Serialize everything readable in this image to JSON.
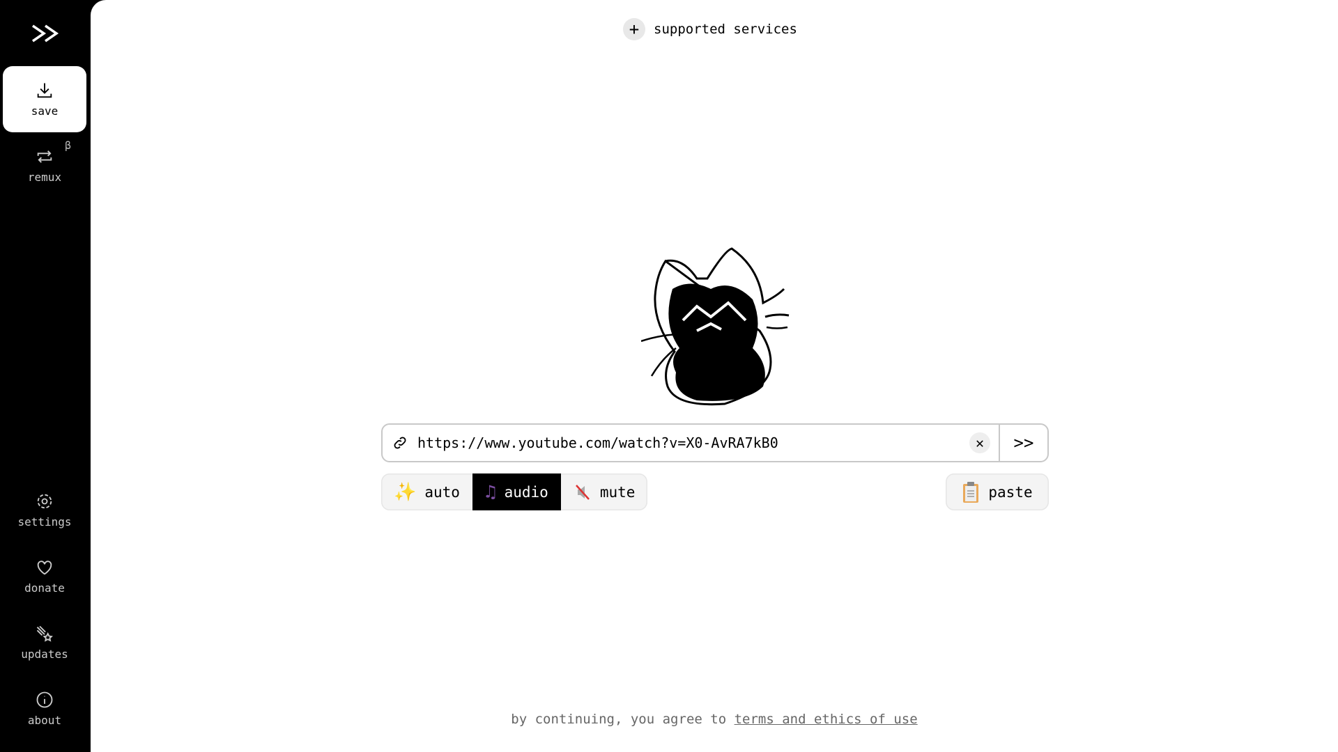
{
  "sidebar": {
    "top": [
      {
        "label": "save",
        "icon": "download-icon",
        "active": true
      },
      {
        "label": "remux",
        "icon": "repeat-icon",
        "badge": "β"
      }
    ],
    "bottom": [
      {
        "label": "settings",
        "icon": "gear-icon"
      },
      {
        "label": "donate",
        "icon": "heart-icon"
      },
      {
        "label": "updates",
        "icon": "sparkle-star-icon"
      },
      {
        "label": "about",
        "icon": "info-icon"
      }
    ]
  },
  "header": {
    "supported_services": "supported services"
  },
  "input": {
    "value": "https://www.youtube.com/watch?v=X0-AvRA7kB0",
    "clear": "✕",
    "go": ">>"
  },
  "modes": [
    {
      "label": "auto",
      "icon": "sparkles-icon"
    },
    {
      "label": "audio",
      "icon": "music-notes-icon",
      "active": true
    },
    {
      "label": "mute",
      "icon": "muted-speaker-icon"
    }
  ],
  "paste": {
    "label": "paste",
    "icon": "clipboard-icon"
  },
  "footer": {
    "prefix": "by continuing, you agree to",
    "link": "terms and ethics of use"
  },
  "colors": {
    "sidebar": "#000000",
    "main": "#ffffff",
    "active_mode": "#000000"
  }
}
